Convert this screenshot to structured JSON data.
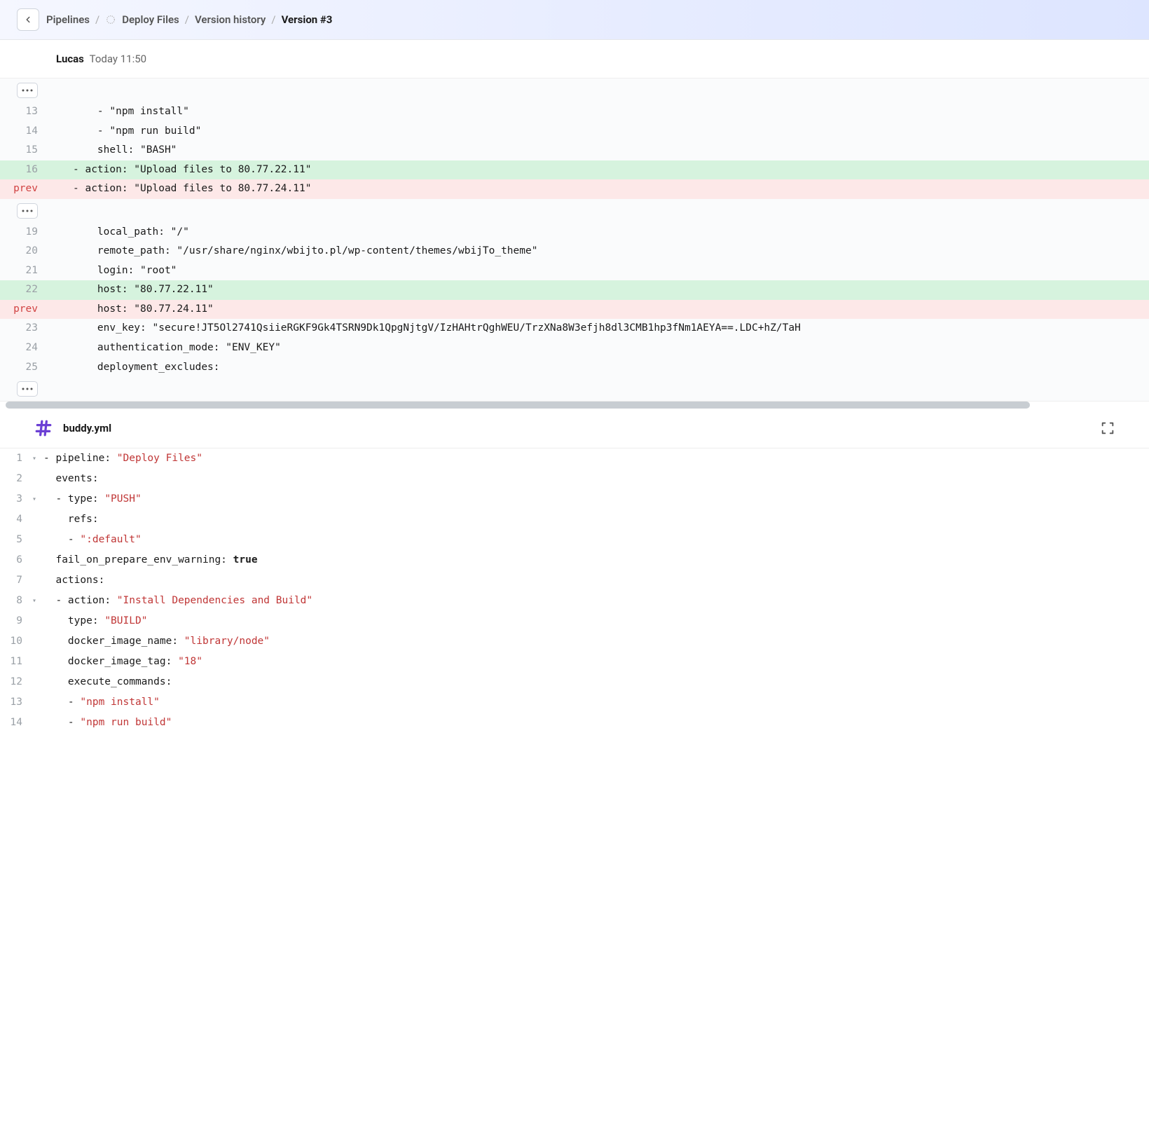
{
  "breadcrumb": {
    "root": "Pipelines",
    "project": "Deploy Files",
    "section": "Version history",
    "current": "Version #3"
  },
  "author": {
    "name": "Lucas",
    "time": "Today 11:50"
  },
  "diff": {
    "rows": [
      {
        "type": "ellipsis"
      },
      {
        "type": "plain",
        "num": "13",
        "text": "    - \"npm install\""
      },
      {
        "type": "plain",
        "num": "14",
        "text": "    - \"npm run build\""
      },
      {
        "type": "plain",
        "num": "15",
        "text": "    shell: \"BASH\""
      },
      {
        "type": "add",
        "num": "16",
        "text": "- action: \"Upload files to 80.77.22.11\""
      },
      {
        "type": "del",
        "num": "prev",
        "text": "- action: \"Upload files to 80.77.24.11\""
      },
      {
        "type": "ellipsis"
      },
      {
        "type": "plain",
        "num": "19",
        "text": "    local_path: \"/\""
      },
      {
        "type": "plain",
        "num": "20",
        "text": "    remote_path: \"/usr/share/nginx/wbijto.pl/wp-content/themes/wbijTo_theme\""
      },
      {
        "type": "plain",
        "num": "21",
        "text": "    login: \"root\""
      },
      {
        "type": "add",
        "num": "22",
        "text": "    host: \"80.77.22.11\""
      },
      {
        "type": "del",
        "num": "prev",
        "text": "    host: \"80.77.24.11\""
      },
      {
        "type": "plain",
        "num": "23",
        "text": "    env_key: \"secure!JT5Ol2741QsiieRGKF9Gk4TSRN9Dk1QpgNjtgV/IzHAHtrQghWEU/TrzXNa8W3efjh8dl3CMB1hp3fNm1AEYA==.LDC+hZ/TaH"
      },
      {
        "type": "plain",
        "num": "24",
        "text": "    authentication_mode: \"ENV_KEY\""
      },
      {
        "type": "plain",
        "num": "25",
        "text": "    deployment_excludes:"
      },
      {
        "type": "ellipsis"
      }
    ]
  },
  "file": {
    "name": "buddy.yml"
  },
  "code": {
    "lines": [
      {
        "num": "1",
        "fold": true,
        "tokens": [
          {
            "t": "punc",
            "v": "- "
          },
          {
            "t": "key",
            "v": "pipeline"
          },
          {
            "t": "punc",
            "v": ": "
          },
          {
            "t": "str",
            "v": "\"Deploy Files\""
          }
        ]
      },
      {
        "num": "2",
        "tokens": [
          {
            "t": "punc",
            "v": "  "
          },
          {
            "t": "key",
            "v": "events"
          },
          {
            "t": "punc",
            "v": ":"
          }
        ]
      },
      {
        "num": "3",
        "fold": true,
        "tokens": [
          {
            "t": "punc",
            "v": "  - "
          },
          {
            "t": "key",
            "v": "type"
          },
          {
            "t": "punc",
            "v": ": "
          },
          {
            "t": "str",
            "v": "\"PUSH\""
          }
        ]
      },
      {
        "num": "4",
        "tokens": [
          {
            "t": "punc",
            "v": "    "
          },
          {
            "t": "key",
            "v": "refs"
          },
          {
            "t": "punc",
            "v": ":"
          }
        ]
      },
      {
        "num": "5",
        "tokens": [
          {
            "t": "punc",
            "v": "    - "
          },
          {
            "t": "str",
            "v": "\":default\""
          }
        ]
      },
      {
        "num": "6",
        "tokens": [
          {
            "t": "punc",
            "v": "  "
          },
          {
            "t": "key",
            "v": "fail_on_prepare_env_warning"
          },
          {
            "t": "punc",
            "v": ": "
          },
          {
            "t": "bool",
            "v": "true"
          }
        ]
      },
      {
        "num": "7",
        "tokens": [
          {
            "t": "punc",
            "v": "  "
          },
          {
            "t": "key",
            "v": "actions"
          },
          {
            "t": "punc",
            "v": ":"
          }
        ]
      },
      {
        "num": "8",
        "fold": true,
        "tokens": [
          {
            "t": "punc",
            "v": "  - "
          },
          {
            "t": "key",
            "v": "action"
          },
          {
            "t": "punc",
            "v": ": "
          },
          {
            "t": "str",
            "v": "\"Install Dependencies and Build\""
          }
        ]
      },
      {
        "num": "9",
        "tokens": [
          {
            "t": "punc",
            "v": "    "
          },
          {
            "t": "key",
            "v": "type"
          },
          {
            "t": "punc",
            "v": ": "
          },
          {
            "t": "str",
            "v": "\"BUILD\""
          }
        ]
      },
      {
        "num": "10",
        "tokens": [
          {
            "t": "punc",
            "v": "    "
          },
          {
            "t": "key",
            "v": "docker_image_name"
          },
          {
            "t": "punc",
            "v": ": "
          },
          {
            "t": "str",
            "v": "\"library/node\""
          }
        ]
      },
      {
        "num": "11",
        "tokens": [
          {
            "t": "punc",
            "v": "    "
          },
          {
            "t": "key",
            "v": "docker_image_tag"
          },
          {
            "t": "punc",
            "v": ": "
          },
          {
            "t": "str",
            "v": "\"18\""
          }
        ]
      },
      {
        "num": "12",
        "tokens": [
          {
            "t": "punc",
            "v": "    "
          },
          {
            "t": "key",
            "v": "execute_commands"
          },
          {
            "t": "punc",
            "v": ":"
          }
        ]
      },
      {
        "num": "13",
        "tokens": [
          {
            "t": "punc",
            "v": "    - "
          },
          {
            "t": "str",
            "v": "\"npm install\""
          }
        ]
      },
      {
        "num": "14",
        "tokens": [
          {
            "t": "punc",
            "v": "    - "
          },
          {
            "t": "str",
            "v": "\"npm run build\""
          }
        ]
      }
    ]
  }
}
